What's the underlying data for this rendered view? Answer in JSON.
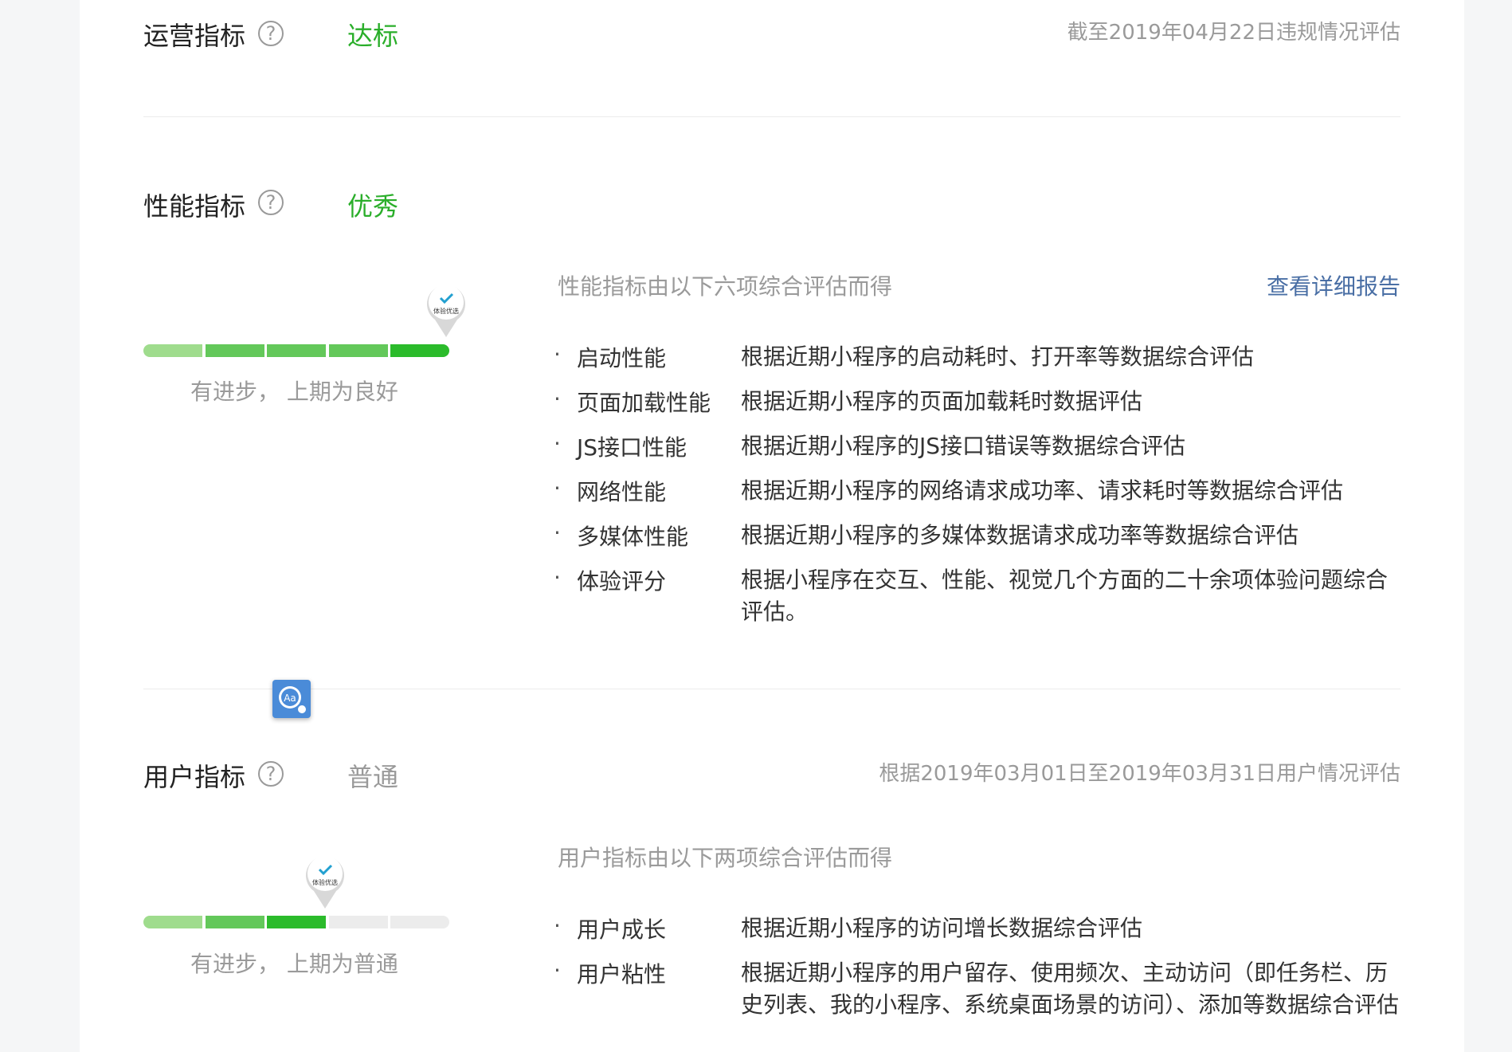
{
  "colors": {
    "green": "#2aae2a",
    "gray_status": "#9a9a9a",
    "link": "#4a6fa5",
    "bar_fill_light": "#9fdc8d",
    "bar_fill_dark": "#2bbb2b",
    "bar_empty": "#ececec"
  },
  "operation": {
    "title": "运营指标",
    "help": "?",
    "status": "达标",
    "status_color": "#2aae2a",
    "meta": "截至2019年04月22日违规情况评估"
  },
  "performance": {
    "title": "性能指标",
    "help": "?",
    "status": "优秀",
    "status_color": "#2aae2a",
    "level_filled": 5,
    "level_total": 5,
    "badge": "体验优选",
    "progress_note": "有进步，  上期为良好",
    "desc_head": "性能指标由以下六项综合评估而得",
    "report_link": "查看详细报告",
    "items": [
      {
        "name": "启动性能",
        "text": "根据近期小程序的启动耗时、打开率等数据综合评估"
      },
      {
        "name": "页面加载性能",
        "text": "根据近期小程序的页面加载耗时数据评估"
      },
      {
        "name": "JS接口性能",
        "text": "根据近期小程序的JS接口错误等数据综合评估"
      },
      {
        "name": "网络性能",
        "text": "根据近期小程序的网络请求成功率、请求耗时等数据综合评估"
      },
      {
        "name": "多媒体性能",
        "text": "根据近期小程序的多媒体数据请求成功率等数据综合评估"
      },
      {
        "name": "体验评分",
        "text": "根据小程序在交互、性能、视觉几个方面的二十余项体验问题综合评估。"
      }
    ]
  },
  "user": {
    "title": "用户指标",
    "help": "?",
    "status": "普通",
    "status_color": "#9a9a9a",
    "meta": "根据2019年03月01日至2019年03月31日用户情况评估",
    "level_filled": 3,
    "level_total": 5,
    "badge": "体验优选",
    "progress_note": "有进步，  上期为普通",
    "desc_head": "用户指标由以下两项综合评估而得",
    "items": [
      {
        "name": "用户成长",
        "text": "根据近期小程序的访问增长数据综合评估"
      },
      {
        "name": "用户粘性",
        "text": "根据近期小程序的用户留存、使用频次、主动访问（即任务栏、历史列表、我的小程序、系统桌面场景的访问）、添加等数据综合评估"
      }
    ]
  },
  "floating_tool": {
    "label": "Aa"
  },
  "bullet": "·"
}
